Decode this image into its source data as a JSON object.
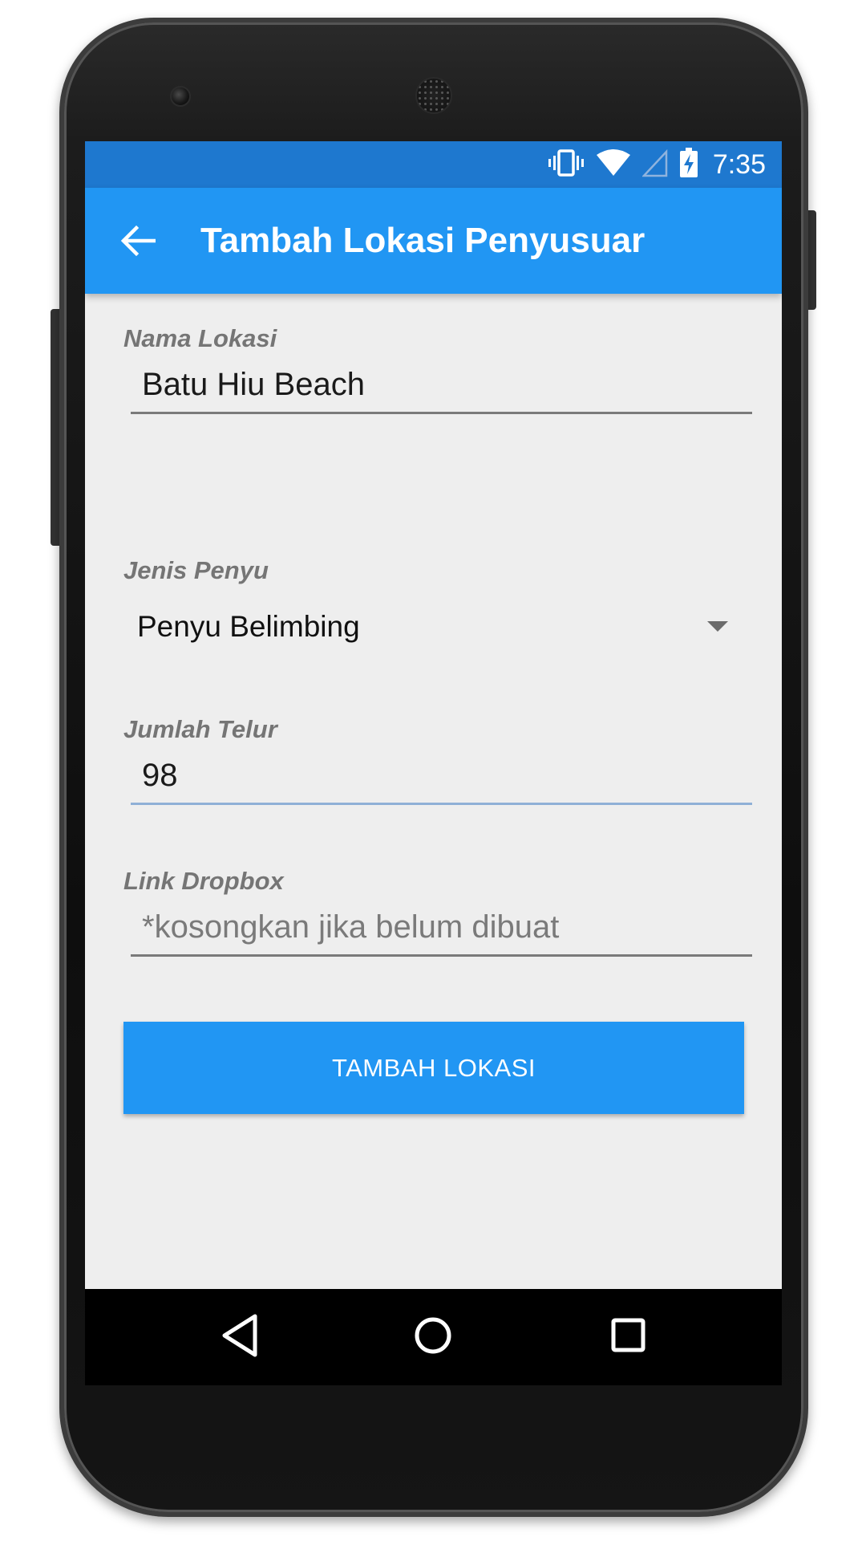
{
  "status_bar": {
    "time": "7:35",
    "icons": [
      "vibrate-icon",
      "wifi-icon",
      "cell-signal-icon",
      "battery-charging-icon"
    ]
  },
  "app_bar": {
    "title": "Tambah Lokasi Penyusuar",
    "back_icon": "arrow-left-icon",
    "color": "#2196f3"
  },
  "form": {
    "nama_lokasi": {
      "label": "Nama Lokasi",
      "value": "Batu Hiu Beach"
    },
    "jenis_penyu": {
      "label": "Jenis Penyu",
      "selected": "Penyu Belimbing"
    },
    "jumlah_telur": {
      "label": "Jumlah Telur",
      "value": "98"
    },
    "link_dropbox": {
      "label": "Link Dropbox",
      "placeholder": "*kosongkan jika belum dibuat"
    },
    "submit_label": "TAMBAH LOKASI"
  },
  "nav_bar": {
    "buttons": [
      "back-triangle-icon",
      "home-circle-icon",
      "recents-square-icon"
    ]
  },
  "colors": {
    "status_bar": "#1e78cf",
    "primary": "#2196f3",
    "background": "#eeeeee"
  }
}
